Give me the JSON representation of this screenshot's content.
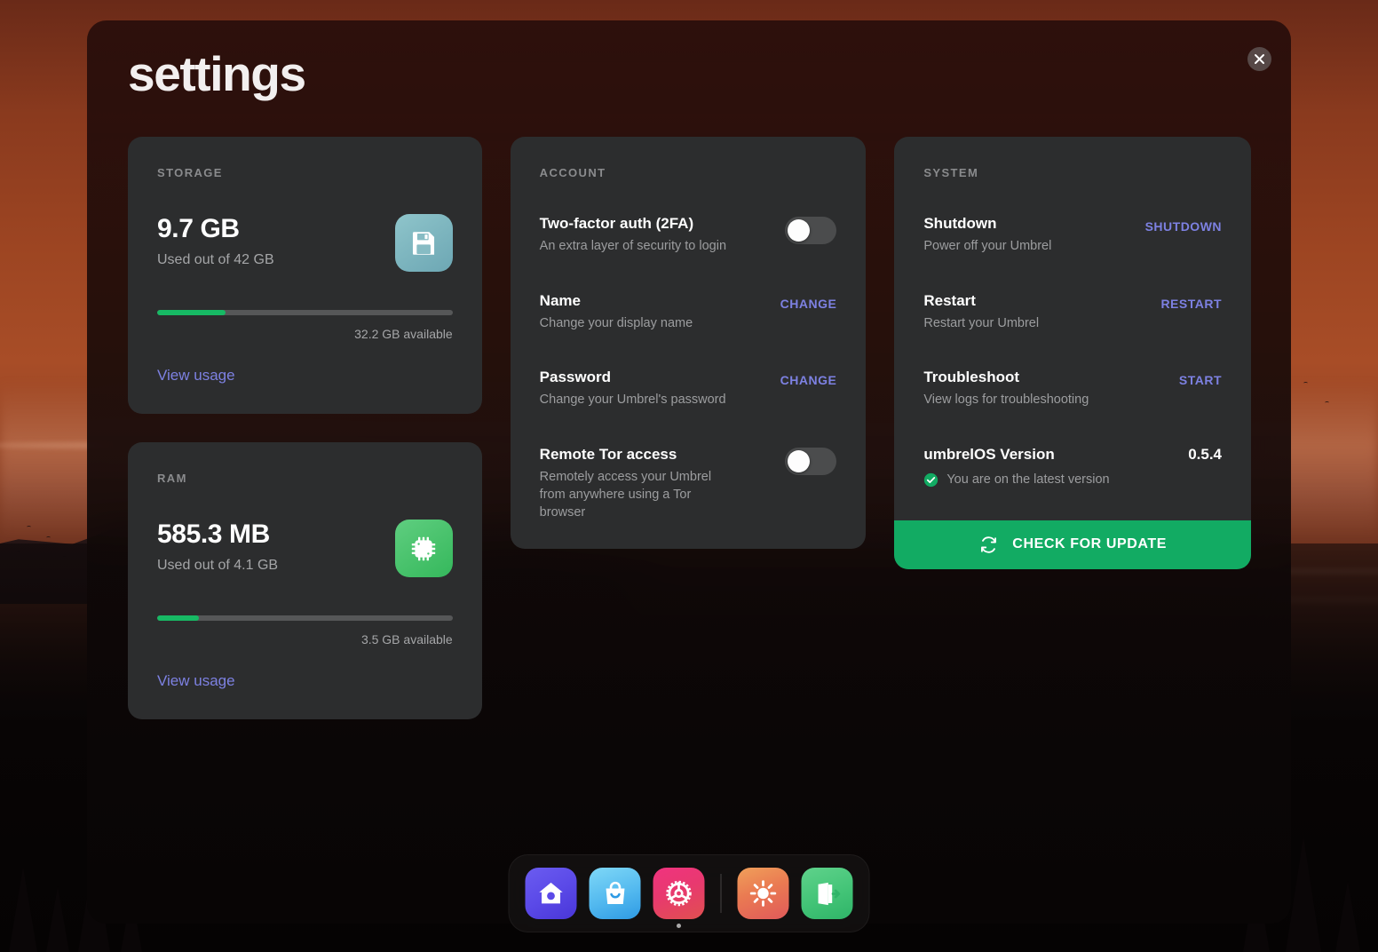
{
  "window": {
    "title": "settings",
    "close_icon": "close-icon"
  },
  "storage": {
    "label": "STORAGE",
    "value": "9.7 GB",
    "subtitle": "Used out of 42 GB",
    "available": "32.2 GB available",
    "link": "View usage",
    "icon": "floppy-disk-icon",
    "used_percent": 23
  },
  "ram": {
    "label": "RAM",
    "value": "585.3 MB",
    "subtitle": "Used out of 4.1 GB",
    "available": "3.5 GB available",
    "link": "View usage",
    "icon": "memory-chip-icon",
    "used_percent": 14
  },
  "account": {
    "label": "ACCOUNT",
    "two_factor": {
      "title": "Two-factor auth (2FA)",
      "desc": "An extra layer of security to login",
      "enabled": false
    },
    "name": {
      "title": "Name",
      "desc": "Change your display name",
      "action": "CHANGE"
    },
    "password": {
      "title": "Password",
      "desc": "Change your Umbrel's password",
      "action": "CHANGE"
    },
    "tor": {
      "title": "Remote Tor access",
      "desc": "Remotely access your Umbrel from anywhere using a Tor browser",
      "enabled": false
    }
  },
  "system": {
    "label": "SYSTEM",
    "shutdown": {
      "title": "Shutdown",
      "desc": "Power off your Umbrel",
      "action": "SHUTDOWN"
    },
    "restart": {
      "title": "Restart",
      "desc": "Restart your Umbrel",
      "action": "RESTART"
    },
    "troubleshoot": {
      "title": "Troubleshoot",
      "desc": "View logs for troubleshooting",
      "action": "START"
    },
    "version": {
      "title": "umbrelOS Version",
      "value": "0.5.4",
      "status": "You are on the latest version",
      "status_icon": "check-circle-icon"
    },
    "update_button": {
      "label": "CHECK FOR UPDATE",
      "icon": "refresh-icon"
    }
  },
  "dock": {
    "items": [
      {
        "name": "home-icon",
        "active": false
      },
      {
        "name": "app-store-icon",
        "active": false
      },
      {
        "name": "settings-gear-icon",
        "active": true
      },
      {
        "name": "brightness-sun-icon",
        "active": false
      },
      {
        "name": "logout-door-icon",
        "active": false
      }
    ]
  },
  "colors": {
    "accent_link": "#7d81e2",
    "progress_green": "#17b964",
    "update_green": "#12ab63",
    "card_bg": "#2c2d2e"
  }
}
